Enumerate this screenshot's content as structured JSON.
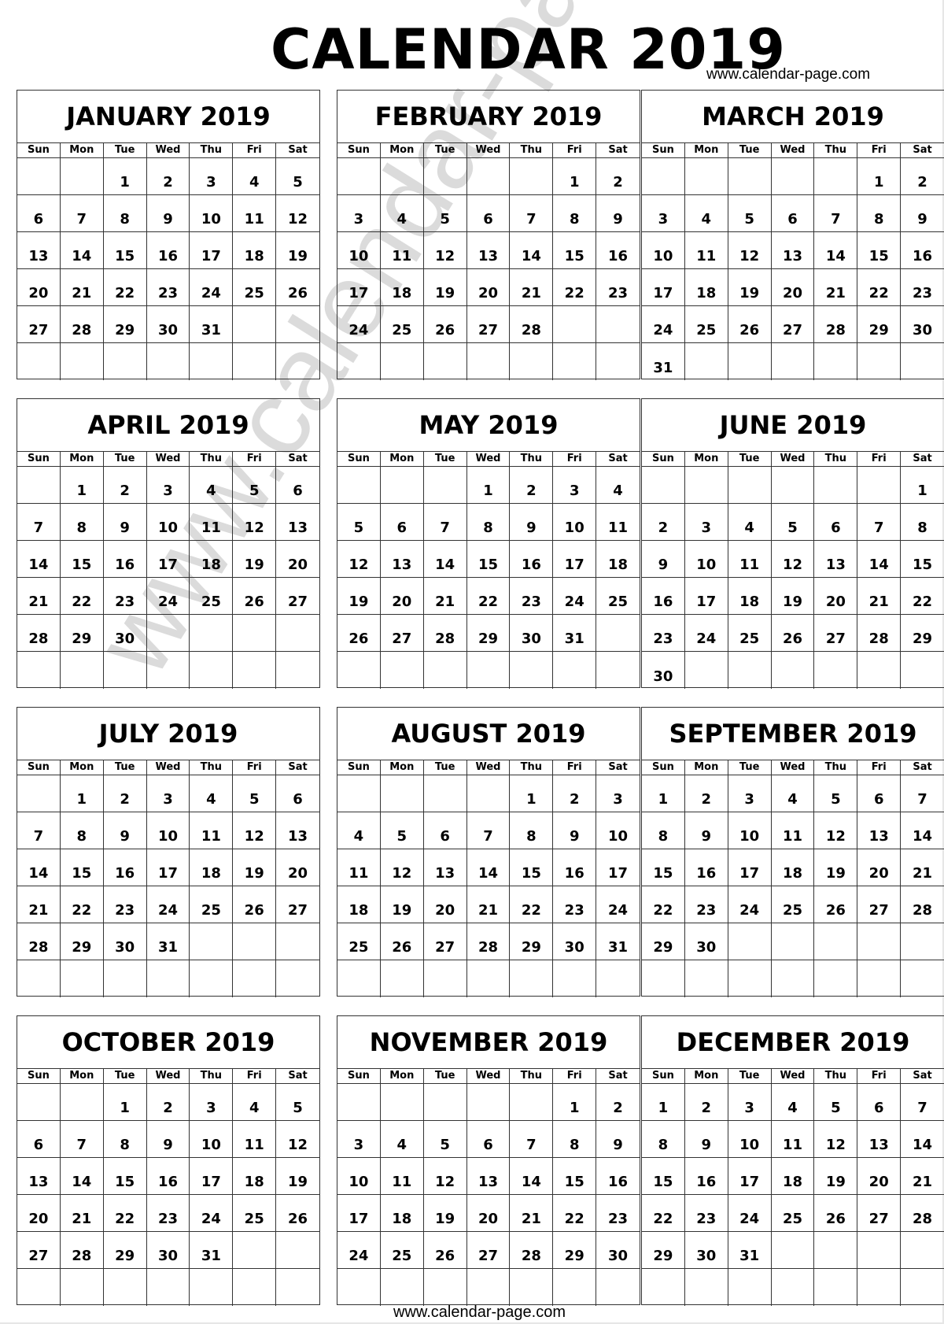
{
  "title": "CALENDAR 2019",
  "site_url_top": "www.calendar-page.com",
  "site_url_bottom": "www.calendar-page.com",
  "watermark": "www.calendar-page.com",
  "weekdays": [
    "Sun",
    "Mon",
    "Tue",
    "Wed",
    "Thu",
    "Fri",
    "Sat"
  ],
  "months": [
    {
      "name": "JANUARY 2019",
      "start": 2,
      "days": 31
    },
    {
      "name": "FEBRUARY 2019",
      "start": 5,
      "days": 28
    },
    {
      "name": "MARCH 2019",
      "start": 5,
      "days": 31
    },
    {
      "name": "APRIL 2019",
      "start": 1,
      "days": 30
    },
    {
      "name": "MAY 2019",
      "start": 3,
      "days": 31
    },
    {
      "name": "JUNE 2019",
      "start": 6,
      "days": 30
    },
    {
      "name": "JULY 2019",
      "start": 1,
      "days": 31
    },
    {
      "name": "AUGUST 2019",
      "start": 4,
      "days": 31
    },
    {
      "name": "SEPTEMBER 2019",
      "start": 0,
      "days": 30
    },
    {
      "name": "OCTOBER 2019",
      "start": 2,
      "days": 31
    },
    {
      "name": "NOVEMBER 2019",
      "start": 5,
      "days": 30
    },
    {
      "name": "DECEMBER 2019",
      "start": 0,
      "days": 31
    }
  ]
}
